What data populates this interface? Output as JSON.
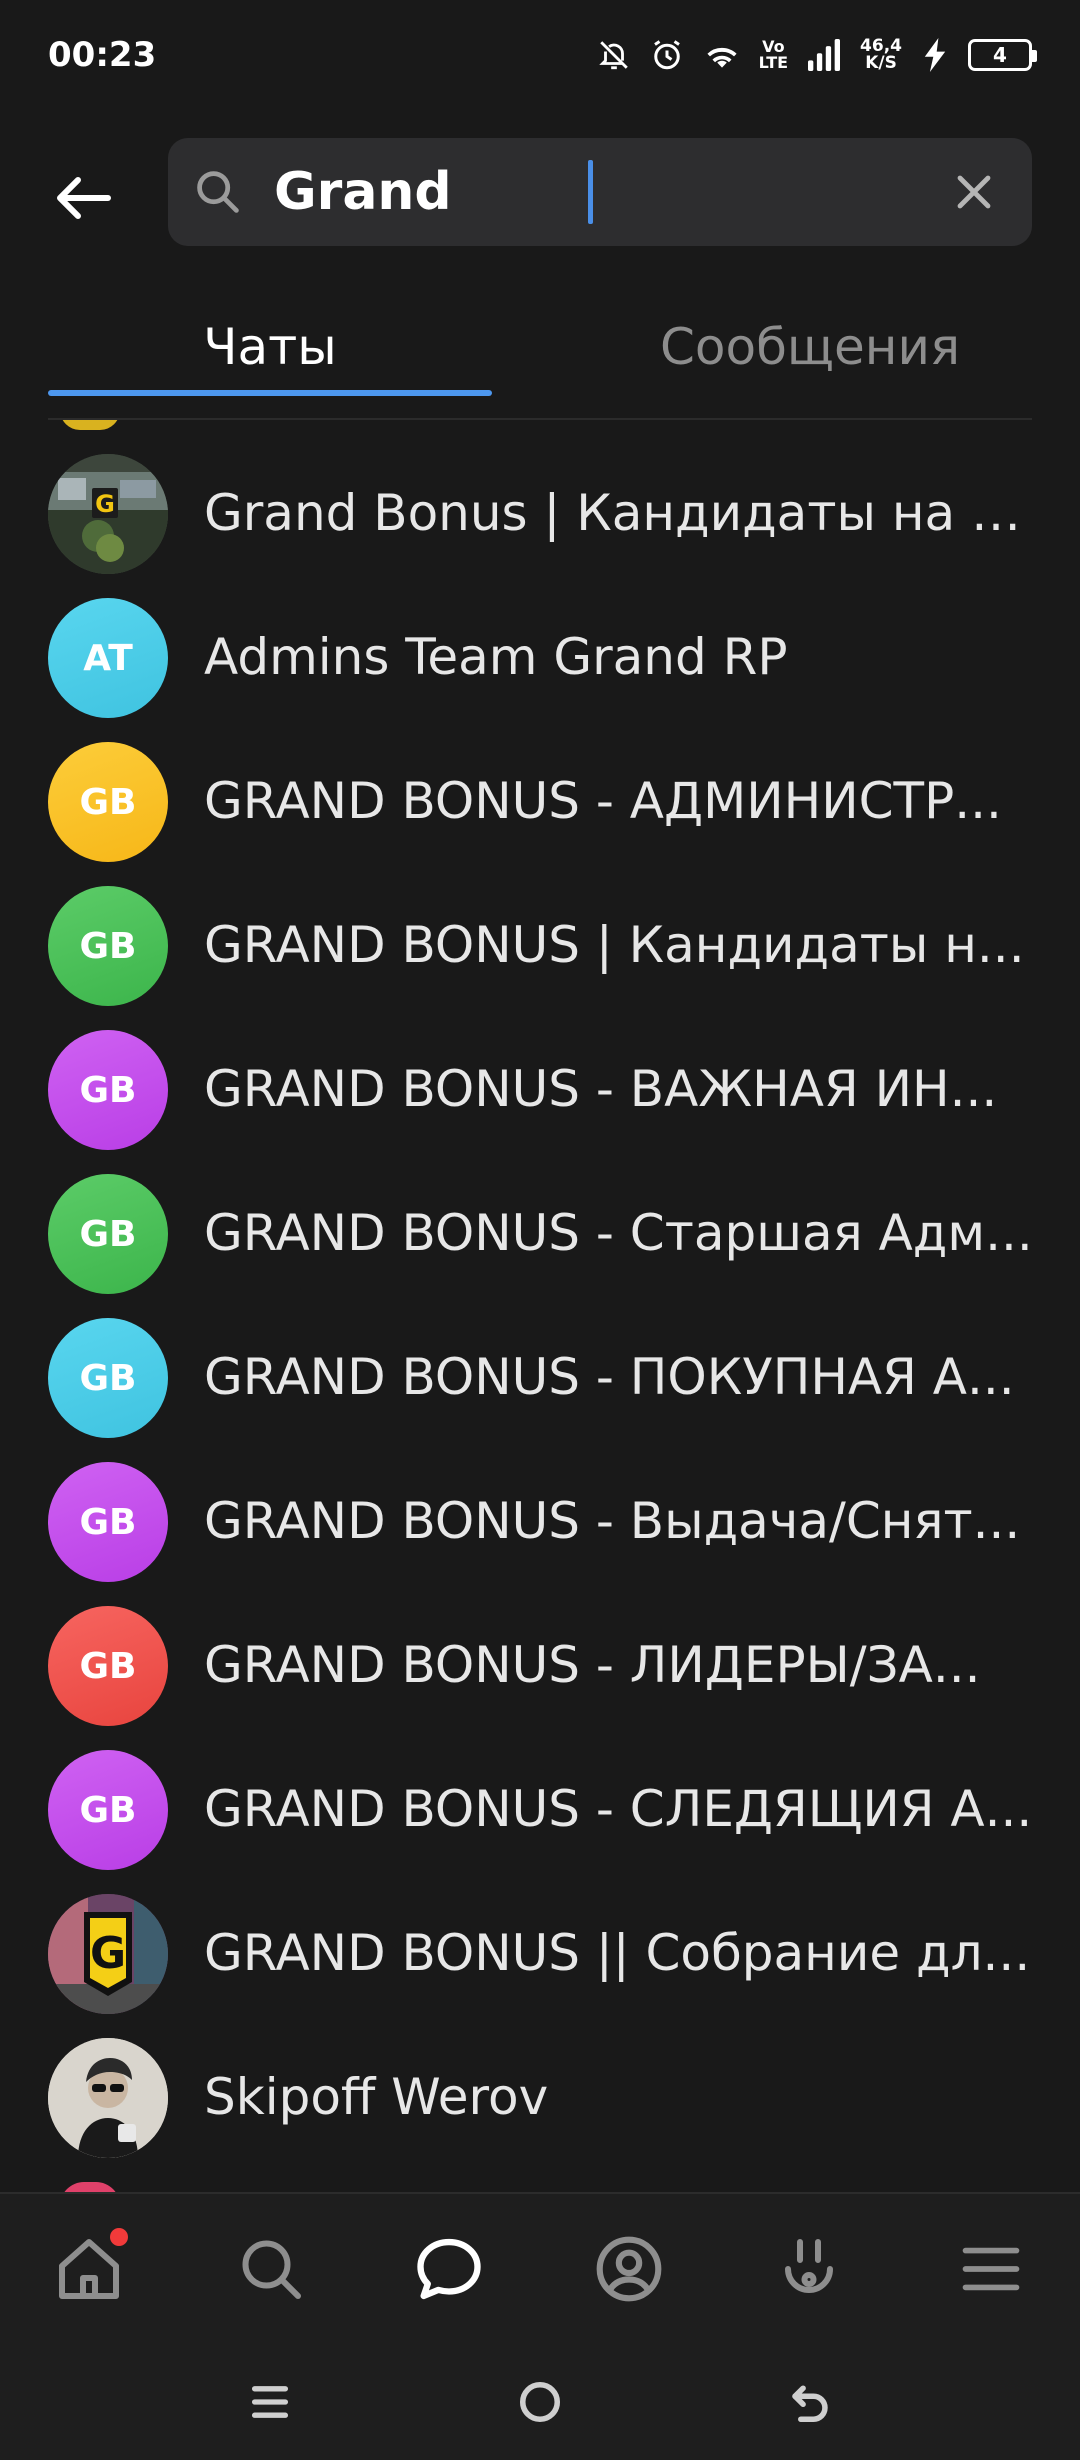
{
  "status_bar": {
    "time": "00:23",
    "network_speed_value": "46,4",
    "network_speed_unit": "K/S",
    "volte_top": "Vo",
    "volte_bottom": "LTE",
    "battery_level": "4"
  },
  "header": {
    "back_icon": "arrow-left-icon",
    "search_icon": "search-icon",
    "search_value": "Grand",
    "clear_icon": "close-icon"
  },
  "tabs": [
    {
      "label": "Чаты",
      "active": true
    },
    {
      "label": "Сообщения",
      "active": false
    }
  ],
  "chats": [
    {
      "title": "Grand Bonus | Кандидаты на п...",
      "avatar_type": "image",
      "avatar_bg": "#3a4a3a"
    },
    {
      "title": "Admins Team Grand  RP",
      "avatar_initials": "AT",
      "avatar_bg": "#3fc3e0",
      "avatar_bg2": "#59d6ef"
    },
    {
      "title": "GRAND BONUS - АДМИНИСТР...",
      "avatar_initials": "GB",
      "avatar_bg": "#f7b718",
      "avatar_bg2": "#fccd3a"
    },
    {
      "title": "GRAND BONUS | Кандидаты н...",
      "avatar_initials": "GB",
      "avatar_bg": "#3cb54b",
      "avatar_bg2": "#5ccc68"
    },
    {
      "title": "GRAND BONUS - ВАЖНАЯ ИН...",
      "avatar_initials": "GB",
      "avatar_bg": "#b93ee6",
      "avatar_bg2": "#cf62f2"
    },
    {
      "title": "GRAND BONUS - Старшая Адм...",
      "avatar_initials": "GB",
      "avatar_bg": "#3cb54b",
      "avatar_bg2": "#5ccc68"
    },
    {
      "title": "GRAND BONUS - ПОКУПНАЯ А...",
      "avatar_initials": "GB",
      "avatar_bg": "#3fc3e0",
      "avatar_bg2": "#59d6ef"
    },
    {
      "title": "GRAND BONUS - Выдача/Сня‌т...",
      "avatar_initials": "GB",
      "avatar_bg": "#b93ee6",
      "avatar_bg2": "#cf62f2"
    },
    {
      "title": "GRAND BONUS - ЛИДЕРЫ/ЗА...",
      "avatar_initials": "GB",
      "avatar_bg": "#e8443e",
      "avatar_bg2": "#f76560"
    },
    {
      "title": "GRAND BONUS - СЛЕДЯЩИЯ А...",
      "avatar_initials": "GB",
      "avatar_bg": "#b93ee6",
      "avatar_bg2": "#cf62f2"
    },
    {
      "title": "GRAND BONUS || Собрание дл...",
      "avatar_type": "image-logo",
      "avatar_bg": "#5a3a5a"
    },
    {
      "title": "Skipoff Werov",
      "avatar_type": "image-photo",
      "avatar_bg": "#d8d4cc"
    }
  ],
  "bottom_nav": [
    {
      "icon": "home-icon",
      "active": false,
      "badge": true
    },
    {
      "icon": "search-icon",
      "active": false,
      "badge": false
    },
    {
      "icon": "chat-bubble-icon",
      "active": true,
      "badge": false
    },
    {
      "icon": "profile-icon",
      "active": false,
      "badge": false
    },
    {
      "icon": "services-icon",
      "active": false,
      "badge": false
    },
    {
      "icon": "menu-icon",
      "active": false,
      "badge": false
    }
  ],
  "colors": {
    "background": "#191919",
    "accent": "#4d97ee",
    "text_primary": "#e7e7e7",
    "text_muted": "#8d8d8d",
    "badge": "#f23a3a"
  }
}
